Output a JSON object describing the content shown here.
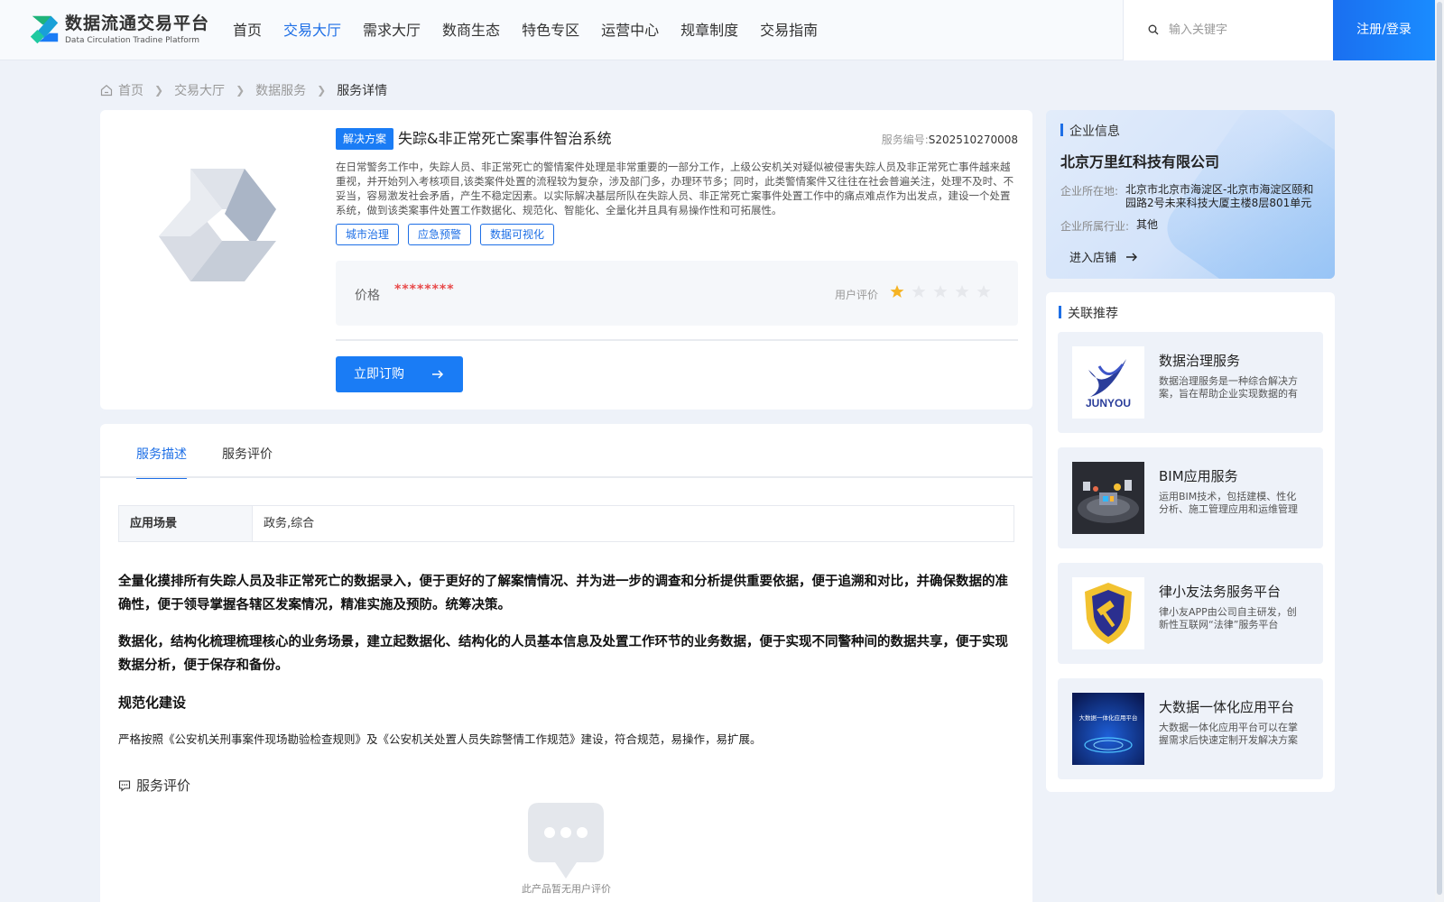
{
  "header": {
    "logo_title": "数据流通交易平台",
    "logo_subtitle": "Data Circulation Tradine Platform",
    "nav": [
      {
        "label": "首页",
        "active": false
      },
      {
        "label": "交易大厅",
        "active": true
      },
      {
        "label": "需求大厅",
        "active": false
      },
      {
        "label": "数商生态",
        "active": false
      },
      {
        "label": "特色专区",
        "active": false
      },
      {
        "label": "运营中心",
        "active": false
      },
      {
        "label": "规章制度",
        "active": false
      },
      {
        "label": "交易指南",
        "active": false
      }
    ],
    "search_placeholder": "输入关键字",
    "login_label": "注册/登录"
  },
  "breadcrumb": [
    "首页",
    "交易大厅",
    "数据服务",
    "服务详情"
  ],
  "product": {
    "type_tag": "解决方案",
    "title": "失踪&非正常死亡案事件智治系统",
    "service_no_label": "服务编号:",
    "service_no": "S202510270008",
    "description": "在日常警务工作中，失踪人员、非正常死亡的警情案件处理是非常重要的一部分工作，上级公安机关对疑似被侵害失踪人员及非正常死亡事件越来越重视，并开始列入考核项目,该类案件处置的流程较为复杂，涉及部门多，办理环节多；同时，此类警情案件又往往在社会普遍关注，处理不及时、不妥当，容易激发社会矛盾，产生不稳定因素。以实际解决基层所队在失踪人员、非正常死亡案事件处置工作中的痛点难点作为出发点，建设一个处置系统，做到该类案事件处置工作数据化、规范化、智能化、全量化并且具有易操作性和可拓展性。",
    "tags": [
      "城市治理",
      "应急预警",
      "数据可视化"
    ],
    "price_label": "价格",
    "price_value": "********",
    "rating_label": "用户评价",
    "rating": 1,
    "rating_max": 5,
    "buy_label": "立即订购"
  },
  "tabs": [
    {
      "label": "服务描述",
      "active": true
    },
    {
      "label": "服务评价",
      "active": false
    }
  ],
  "detail": {
    "scene_key": "应用场景",
    "scene_value": "政务,综合",
    "para1": "全量化摸排所有失踪人员及非正常死亡的数据录入，便于更好的了解案情情况、并为进一步的调查和分析提供重要依据，便于追溯和对比，并确保数据的准确性，便于领导掌握各辖区发案情况，精准实施及预防。统筹决策。",
    "para2": "数据化，结构化梳理梳理核心的业务场景，建立起数据化、结构化的人员基本信息及处置工作环节的业务数据，便于实现不同警种间的数据共享，便于实现数据分析，便于保存和备份。",
    "heading": "规范化建设",
    "para3": "严格按照《公安机关刑事案件现场勘验检查规则》及《公安机关处置人员失踪警情工作规范》建设，符合规范，易操作，易扩展。",
    "review_title": "服务评价",
    "empty_text": "此产品暂无用户评价"
  },
  "enterprise": {
    "section_title": "企业信息",
    "name": "北京万里红科技有限公司",
    "location_label": "企业所在地:",
    "location": "北京市北京市海淀区-北京市海淀区颐和园路2号未来科技大厦主楼8层801单元",
    "industry_label": "企业所属行业:",
    "industry": "其他",
    "shop_label": "进入店铺"
  },
  "recommend": {
    "section_title": "关联推荐",
    "items": [
      {
        "name": "数据治理服务",
        "desc": "数据治理服务是一种综合解决方案，旨在帮助企业实现数据的有效管理与利用",
        "thumb": "junyou-logo",
        "thumb_text": "JUNYOU"
      },
      {
        "name": "BIM应用服务",
        "desc": "运用BIM技术，包括建模、性化分析、施工管理应用和运维管理等服务",
        "thumb": "bim-scene",
        "thumb_text": ""
      },
      {
        "name": "律小友法务服务平台",
        "desc": "律小友APP由公司自主研发，创新性互联网“法律”服务平台",
        "thumb": "shield-hammer-logo",
        "thumb_text": ""
      },
      {
        "name": "大数据一体化应用平台",
        "desc": "大数据一体化应用平台可以在掌握需求后快速定制开发解决方案",
        "thumb": "bigdata-poster",
        "thumb_text": "大数据一体化应用平台"
      }
    ]
  },
  "colors": {
    "primary": "#1e6fe6",
    "button": "#1a7cf5",
    "price": "#e84a4a",
    "star_on": "#f5b324",
    "star_off": "#e6e8ec"
  }
}
